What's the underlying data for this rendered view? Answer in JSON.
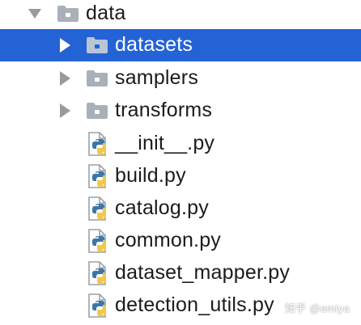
{
  "colors": {
    "selection": "#2463d5",
    "folder": "#a9b0b8",
    "arrow": "#9a9a9a",
    "text": "#1b1b1b"
  },
  "tree": {
    "root": {
      "label": "data",
      "icon": "folder-icon",
      "expanded": true
    },
    "folders": [
      {
        "label": "datasets",
        "icon": "folder-icon",
        "expanded": false,
        "selected": true
      },
      {
        "label": "samplers",
        "icon": "folder-icon",
        "expanded": false,
        "selected": false
      },
      {
        "label": "transforms",
        "icon": "folder-icon",
        "expanded": false,
        "selected": false
      }
    ],
    "files": [
      {
        "label": "__init__.py",
        "icon": "python-file-icon"
      },
      {
        "label": "build.py",
        "icon": "python-file-icon"
      },
      {
        "label": "catalog.py",
        "icon": "python-file-icon"
      },
      {
        "label": "common.py",
        "icon": "python-file-icon"
      },
      {
        "label": "dataset_mapper.py",
        "icon": "python-file-icon"
      },
      {
        "label": "detection_utils.py",
        "icon": "python-file-icon"
      }
    ]
  },
  "watermark": "知乎 @emiya"
}
